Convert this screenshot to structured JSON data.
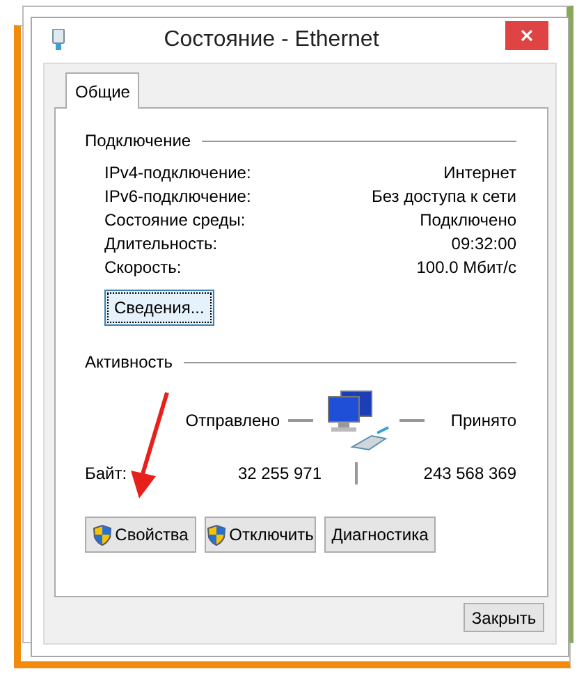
{
  "window": {
    "title": "Состояние - Ethernet"
  },
  "tabs": [
    {
      "label": "Общие",
      "selected": true
    }
  ],
  "connection": {
    "heading": "Подключение",
    "rows": [
      {
        "label": "IPv4-подключение:",
        "value": "Интернет"
      },
      {
        "label": "IPv6-подключение:",
        "value": "Без доступа к сети"
      },
      {
        "label": "Состояние среды:",
        "value": "Подключено"
      },
      {
        "label": "Длительность:",
        "value": "09:32:00"
      },
      {
        "label": "Скорость:",
        "value": "100.0 Мбит/с"
      }
    ],
    "details_button": {
      "label": "Сведения...",
      "focused": true
    }
  },
  "activity": {
    "heading": "Активность",
    "sent_label": "Отправлено",
    "received_label": "Принято",
    "bytes_label": "Байт:",
    "sent": "32 255 971",
    "received": "243 568 369"
  },
  "buttons": [
    {
      "label": "Свойства",
      "kind": "shield"
    },
    {
      "label": "Отключить",
      "kind": "shield"
    },
    {
      "label": "Диагностика",
      "kind": "plain"
    }
  ],
  "close_button": "Закрыть"
}
